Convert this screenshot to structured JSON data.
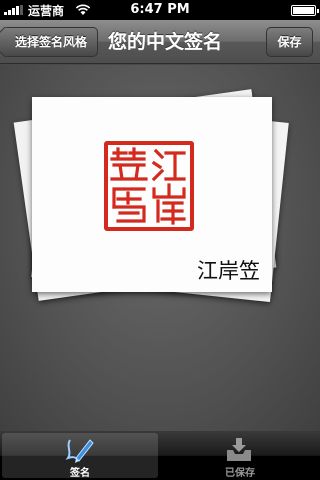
{
  "status_bar": {
    "carrier": "运营商",
    "time": "6:47 PM",
    "battery_level": 1.0
  },
  "nav_bar": {
    "back_label": "选择签名风格",
    "title": "您的中文签名",
    "save_label": "保存"
  },
  "signature": {
    "text": "江岸笠"
  },
  "tab_bar": {
    "tabs": [
      {
        "label": "签名",
        "icon": "pen-icon",
        "selected": true
      },
      {
        "label": "已保存",
        "icon": "tray-download-icon",
        "selected": false
      }
    ]
  },
  "colors": {
    "seal_red": "#d42a1d",
    "nav_bar": "#6c6c6c",
    "background": "#525252"
  }
}
